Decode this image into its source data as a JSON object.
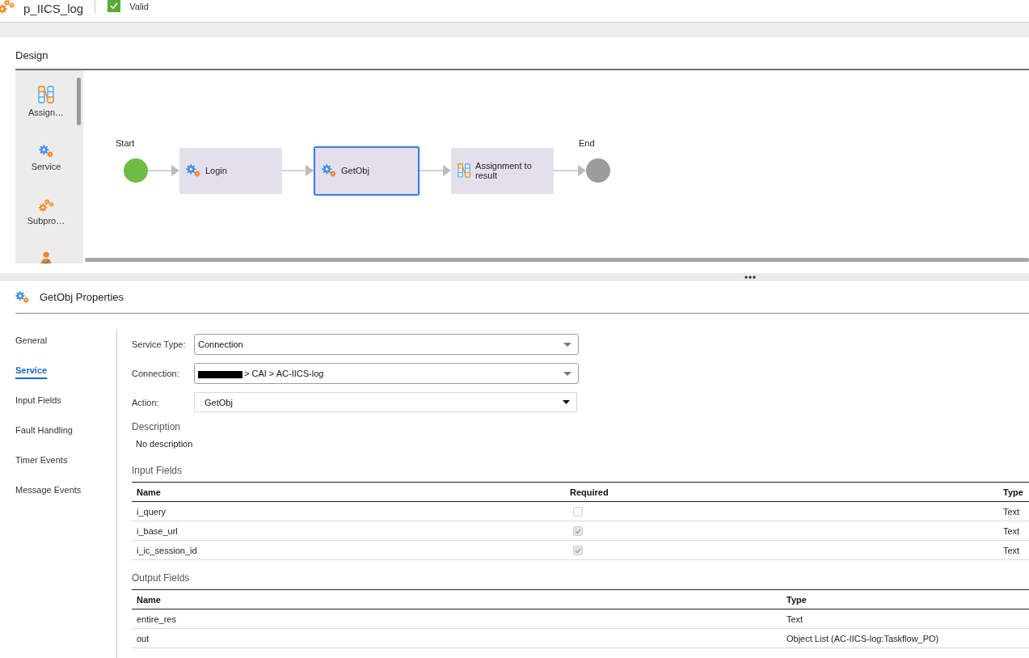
{
  "header": {
    "title": "p_IICS_log",
    "status": {
      "label": "Valid",
      "valid": true
    }
  },
  "design": {
    "title": "Design",
    "palette": [
      {
        "label": "Assign…",
        "kind": "assignment"
      },
      {
        "label": "Service",
        "kind": "service"
      },
      {
        "label": "Subpro…",
        "kind": "subprocess"
      },
      {
        "kind": "human"
      }
    ],
    "flow": {
      "start": {
        "label": "Start"
      },
      "steps": [
        {
          "label": "Login",
          "kind": "service",
          "selected": false
        },
        {
          "label": "GetObj",
          "kind": "service",
          "selected": true
        },
        {
          "label": "Assignment to result",
          "kind": "assignment",
          "selected": false
        }
      ],
      "end": {
        "label": "End"
      }
    }
  },
  "properties": {
    "title": "GetObj Properties",
    "tabs": [
      {
        "label": "General",
        "selected": false
      },
      {
        "label": "Service",
        "selected": true
      },
      {
        "label": "Input Fields",
        "selected": false
      },
      {
        "label": "Fault Handling",
        "selected": false
      },
      {
        "label": "Timer Events",
        "selected": false
      },
      {
        "label": "Message Events",
        "selected": false
      }
    ],
    "form": [
      {
        "label": "Service Type:",
        "value": "Connection",
        "kind": "combo",
        "redacted": false
      },
      {
        "label": "Connection:",
        "value": "> CAI > AC-IICS-log",
        "kind": "combo",
        "redacted": true
      },
      {
        "label": "Action:",
        "value": "GetObj",
        "kind": "select",
        "redacted": false
      }
    ],
    "description": {
      "title": "Description",
      "text": "No description"
    },
    "input_fields": {
      "title": "Input Fields",
      "columns": [
        "Name",
        "Required",
        "Type"
      ],
      "rows": [
        {
          "name": "i_query",
          "required": false,
          "type": "Text"
        },
        {
          "name": "i_base_url",
          "required": true,
          "type": "Text"
        },
        {
          "name": "i_ic_session_id",
          "required": true,
          "type": "Text"
        }
      ]
    },
    "output_fields": {
      "title": "Output Fields",
      "columns": [
        "Name",
        "Type"
      ],
      "rows": [
        {
          "name": "entire_res",
          "type": "Text"
        },
        {
          "name": "out",
          "type": "Object List (AC-IICS-log:Taskflow_PO)"
        }
      ]
    }
  }
}
